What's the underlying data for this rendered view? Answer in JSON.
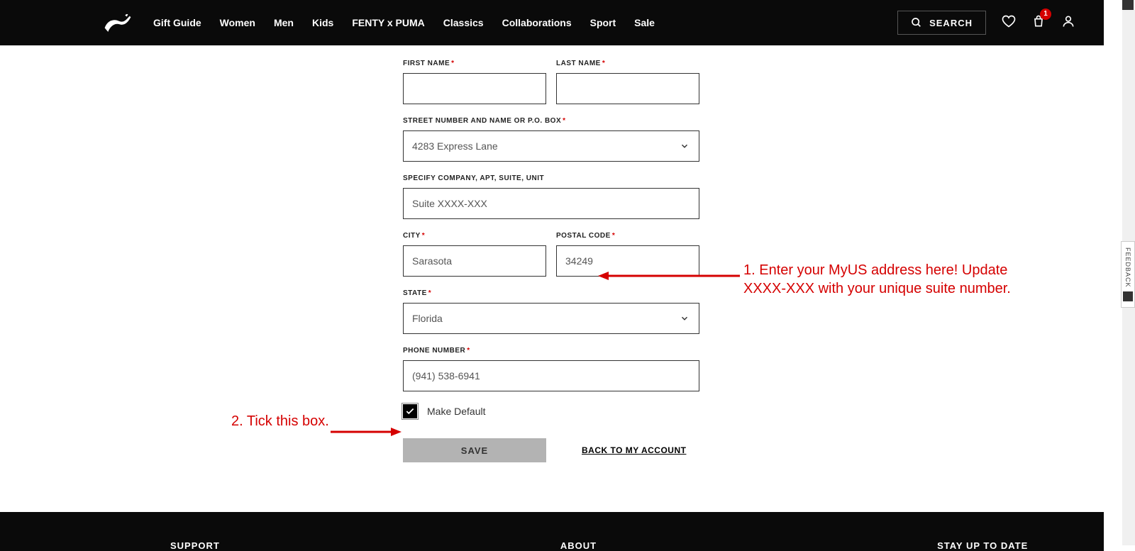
{
  "header": {
    "nav": [
      "Gift Guide",
      "Women",
      "Men",
      "Kids",
      "FENTY x PUMA",
      "Classics",
      "Collaborations",
      "Sport",
      "Sale"
    ],
    "search_label": "SEARCH",
    "cart_badge": "1"
  },
  "form": {
    "first_name": {
      "label": "FIRST NAME",
      "value": ""
    },
    "last_name": {
      "label": "LAST NAME",
      "value": ""
    },
    "street": {
      "label": "STREET NUMBER AND NAME OR P.O. BOX",
      "value": "4283 Express Lane"
    },
    "company": {
      "label": "SPECIFY COMPANY, APT, SUITE, UNIT",
      "value": "Suite XXXX-XXX"
    },
    "city": {
      "label": "CITY",
      "value": "Sarasota"
    },
    "postal": {
      "label": "POSTAL CODE",
      "value": "34249"
    },
    "state": {
      "label": "STATE",
      "value": "Florida"
    },
    "phone": {
      "label": "PHONE NUMBER",
      "value": "(941) 538-6941"
    },
    "make_default": "Make Default",
    "save": "SAVE",
    "back": "BACK TO MY ACCOUNT"
  },
  "annotations": {
    "a1": "1. Enter your MyUS address here! Update XXXX-XXX with your unique suite number.",
    "a2": "2. Tick this box."
  },
  "footer": {
    "col1": "SUPPORT",
    "col2": "ABOUT",
    "col3": "STAY UP TO DATE"
  },
  "feedback": "FEEDBACK"
}
